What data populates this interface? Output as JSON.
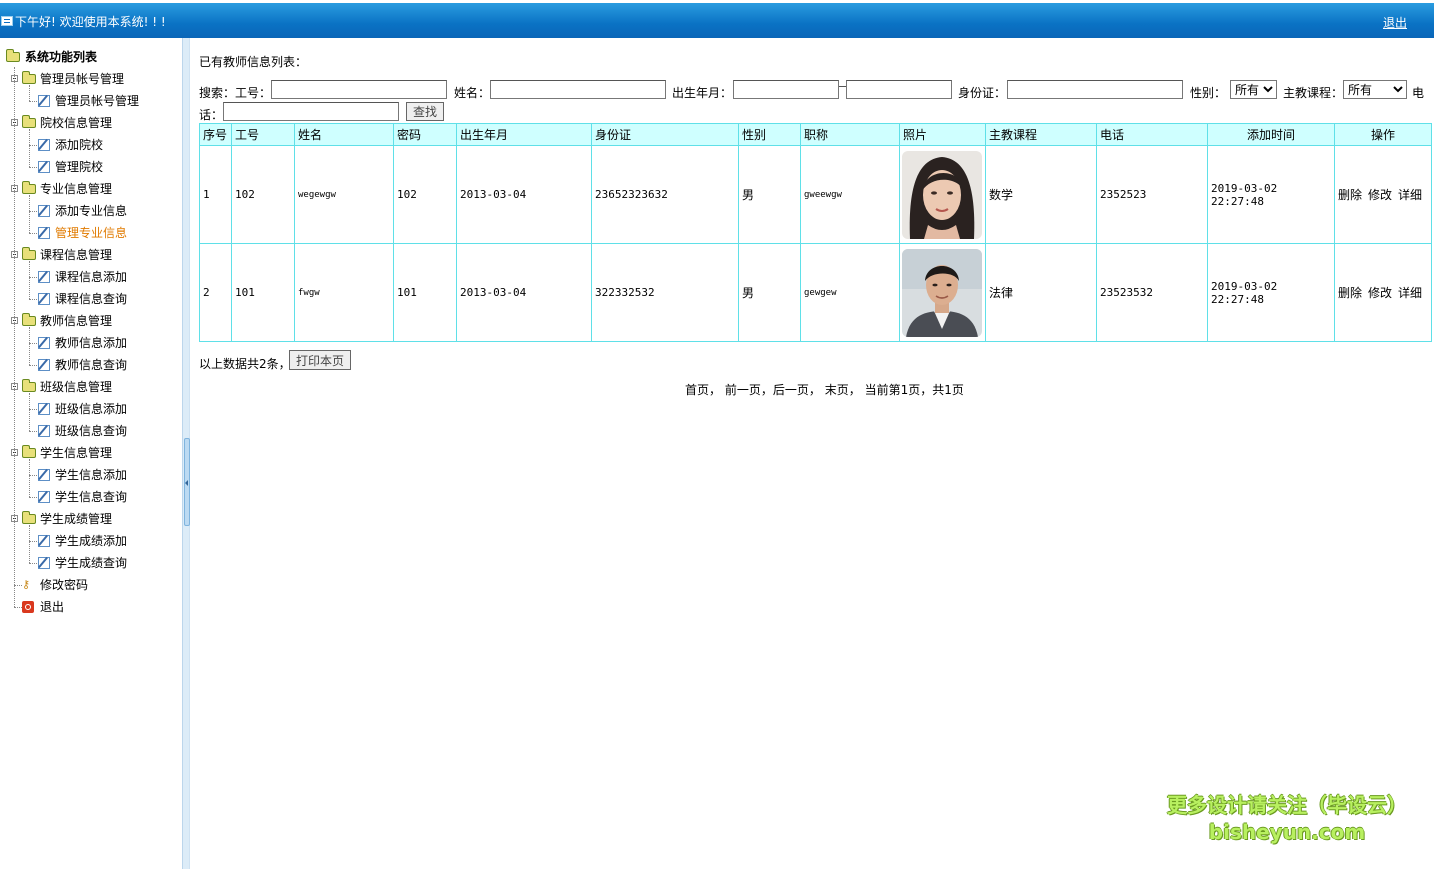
{
  "header": {
    "welcome": "下午好! 欢迎使用本系统! ! !",
    "logout": "退出",
    "bar_color": "#0a72c4"
  },
  "sidebar": {
    "root": "系统功能列表",
    "groups": [
      {
        "label": "管理员帐号管理",
        "items": [
          "管理员帐号管理"
        ]
      },
      {
        "label": "院校信息管理",
        "items": [
          "添加院校",
          "管理院校"
        ]
      },
      {
        "label": "专业信息管理",
        "items": [
          "添加专业信息",
          "管理专业信息"
        ]
      },
      {
        "label": "课程信息管理",
        "items": [
          "课程信息添加",
          "课程信息查询"
        ]
      },
      {
        "label": "教师信息管理",
        "items": [
          "教师信息添加",
          "教师信息查询"
        ]
      },
      {
        "label": "班级信息管理",
        "items": [
          "班级信息添加",
          "班级信息查询"
        ]
      },
      {
        "label": "学生信息管理",
        "items": [
          "学生信息添加",
          "学生信息查询"
        ]
      },
      {
        "label": "学生成绩管理",
        "items": [
          "学生成绩添加",
          "学生成绩查询"
        ]
      }
    ],
    "change_password": "修改密码",
    "logout": "退出",
    "active_item": "管理专业信息",
    "active_color": "#e07a00"
  },
  "main": {
    "list_title": "已有教师信息列表：",
    "search": {
      "label_search": "搜索：",
      "label_id": "工号：",
      "label_name": "姓名：",
      "label_birth": "出生年月：",
      "label_idcard": "身份证：",
      "label_gender": "性别：",
      "gender_value": "所有",
      "label_course": "主教课程：",
      "course_value": "所有",
      "label_phone_1": "电",
      "label_phone_2": "话：",
      "find_button": "查找"
    },
    "table": {
      "headers": [
        "序号",
        "工号",
        "姓名",
        "密码",
        "出生年月",
        "身份证",
        "性别",
        "职称",
        "照片",
        "主教课程",
        "电话",
        "添加时间",
        "操作"
      ],
      "rows": [
        {
          "seq": "1",
          "id": "102",
          "name": "wegewgw",
          "password": "102",
          "birth": "2013-03-04",
          "idcard": "23652323632",
          "gender": "男",
          "title": "gweewgw",
          "photo": "female-portrait",
          "course": "数学",
          "phone": "2352523",
          "added": "2019-03-02 22:27:48"
        },
        {
          "seq": "2",
          "id": "101",
          "name": "fwgw",
          "password": "101",
          "birth": "2013-03-04",
          "idcard": "322332532",
          "gender": "男",
          "title": "gewgew",
          "photo": "male-portrait",
          "course": "法律",
          "phone": "23523532",
          "added": "2019-03-02 22:27:48"
        }
      ],
      "ops": {
        "delete": "删除",
        "edit": "修改",
        "detail": "详细"
      },
      "header_bg": "#cfffff",
      "border_color": "#5fe0e8"
    },
    "summary": "以上数据共2条，",
    "print_button": "打印本页",
    "pager": {
      "first": "首页，",
      "prev": "前一页",
      "sep1": "，",
      "next": "后一页，",
      "last": "末页，",
      "status": "当前第1页，共1页"
    }
  },
  "watermark": {
    "line1": "更多设计请关注（毕设云）",
    "line2": "bisheyun.com"
  }
}
